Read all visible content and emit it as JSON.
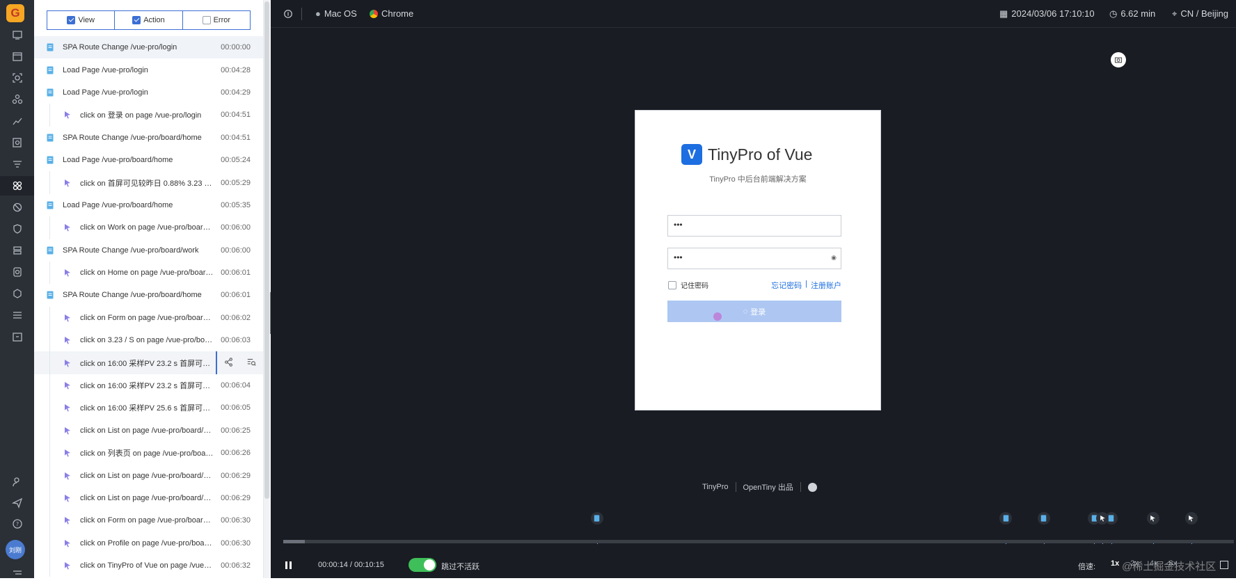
{
  "filters": [
    {
      "label": "View",
      "checked": true
    },
    {
      "label": "Action",
      "checked": true
    },
    {
      "label": "Error",
      "checked": false
    }
  ],
  "events": [
    {
      "type": "view",
      "text": "SPA Route Change /vue-pro/login",
      "time": "00:00:00",
      "level": 0,
      "selected": true
    },
    {
      "type": "view",
      "text": "Load Page /vue-pro/login",
      "time": "00:04:28",
      "level": 0
    },
    {
      "type": "view",
      "text": "Load Page /vue-pro/login",
      "time": "00:04:29",
      "level": 0
    },
    {
      "type": "action",
      "text": "click on 登录 on page /vue-pro/login",
      "time": "00:04:51",
      "level": 1
    },
    {
      "type": "view",
      "text": "SPA Route Change /vue-pro/board/home",
      "time": "00:04:51",
      "level": 0
    },
    {
      "type": "view",
      "text": "Load Page /vue-pro/board/home",
      "time": "00:05:24",
      "level": 0
    },
    {
      "type": "action",
      "text": "click on 首屏可见较昨日 0.88% 3.23 /…",
      "time": "00:05:29",
      "level": 1
    },
    {
      "type": "view",
      "text": "Load Page /vue-pro/board/home",
      "time": "00:05:35",
      "level": 0
    },
    {
      "type": "action",
      "text": "click on Work on page /vue-pro/boar…",
      "time": "00:06:00",
      "level": 1
    },
    {
      "type": "view",
      "text": "SPA Route Change /vue-pro/board/work",
      "time": "00:06:00",
      "level": 0
    },
    {
      "type": "action",
      "text": "click on Home on page /vue-pro/boar…",
      "time": "00:06:01",
      "level": 1
    },
    {
      "type": "view",
      "text": "SPA Route Change /vue-pro/board/home",
      "time": "00:06:01",
      "level": 0
    },
    {
      "type": "action",
      "text": "click on Form on page /vue-pro/boar…",
      "time": "00:06:02",
      "level": 1
    },
    {
      "type": "action",
      "text": "click on 3.23 / S on page /vue-pro/bo…",
      "time": "00:06:03",
      "level": 1
    },
    {
      "type": "action",
      "text": "click on 16:00 采样PV 23.2 s 首屏可…",
      "time": "",
      "level": 1,
      "current": true
    },
    {
      "type": "action",
      "text": "click on 16:00 采样PV 23.2 s 首屏可…",
      "time": "00:06:04",
      "level": 1
    },
    {
      "type": "action",
      "text": "click on 16:00 采样PV 25.6 s 首屏可…",
      "time": "00:06:05",
      "level": 1
    },
    {
      "type": "action",
      "text": "click on List on page /vue-pro/board/…",
      "time": "00:06:25",
      "level": 1
    },
    {
      "type": "action",
      "text": "click on 列表页 on page /vue-pro/boa…",
      "time": "00:06:26",
      "level": 1
    },
    {
      "type": "action",
      "text": "click on List on page /vue-pro/board/…",
      "time": "00:06:29",
      "level": 1
    },
    {
      "type": "action",
      "text": "click on List on page /vue-pro/board/…",
      "time": "00:06:29",
      "level": 1
    },
    {
      "type": "action",
      "text": "click on Form on page /vue-pro/boar…",
      "time": "00:06:30",
      "level": 1
    },
    {
      "type": "action",
      "text": "click on Profile on page /vue-pro/boar…",
      "time": "00:06:30",
      "level": 1
    },
    {
      "type": "action",
      "text": "click on TinyPro of Vue on page /vue-…",
      "time": "00:06:32",
      "level": 1
    }
  ],
  "user": {
    "avatar_text": "刘刚"
  },
  "topbar": {
    "os": "Mac OS",
    "browser": "Chrome",
    "datetime": "2024/03/06 17:10:10",
    "duration": "6.62 min",
    "location": "CN / Beijing"
  },
  "stage": {
    "brand": "TinyPro of Vue",
    "subtitle": "TinyPro 中后台前端解决方案",
    "username_value": "•••",
    "password_value": "•••",
    "remember_label": "记住密码",
    "forgot_link": "忘记密码",
    "link_sep": "|",
    "register_link": "注册账户",
    "login_button": "登录",
    "footer_left": "TinyPro",
    "footer_right": "OpenTiny 出品"
  },
  "timeline": {
    "progress": 0.023,
    "markers": [
      {
        "type": "view",
        "pos": 0.33
      },
      {
        "type": "view",
        "pos": 0.76
      },
      {
        "type": "view",
        "pos": 0.8
      },
      {
        "type": "view",
        "pos": 0.853
      },
      {
        "type": "action",
        "pos": 0.862
      },
      {
        "type": "view",
        "pos": 0.871
      },
      {
        "type": "action",
        "pos": 0.915
      },
      {
        "type": "action",
        "pos": 0.955
      }
    ]
  },
  "controls": {
    "time": "00:00:14 / 00:10:15",
    "skip_inactive_label": "跳过不活跃",
    "skip_inactive_on": true,
    "speed_label": "倍速:",
    "speeds": [
      "1x",
      "2x",
      "4x",
      "8x"
    ],
    "watermark": "@稀土掘金技术社区"
  },
  "colors": {
    "accent": "#3b6fd4",
    "view_icon": "#5ab0e8",
    "action_icon": "#8a7ee6",
    "toggle_on": "#3fbf5a"
  }
}
